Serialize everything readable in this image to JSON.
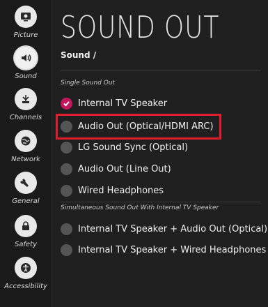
{
  "sidebar": {
    "items": [
      {
        "label": "Picture",
        "icon": "picture-icon"
      },
      {
        "label": "Sound",
        "icon": "speaker-icon"
      },
      {
        "label": "Channels",
        "icon": "antenna-icon"
      },
      {
        "label": "Network",
        "icon": "globe-icon"
      },
      {
        "label": "General",
        "icon": "wrench-icon"
      },
      {
        "label": "Safety",
        "icon": "lock-icon"
      },
      {
        "label": "Accessibility",
        "icon": "accessibility-icon"
      }
    ]
  },
  "header": {
    "title": "SOUND OUT",
    "breadcrumb": "Sound /"
  },
  "sections": {
    "single": {
      "label": "Single Sound Out",
      "options": [
        {
          "label": "Internal TV Speaker",
          "selected": true
        },
        {
          "label": "Audio Out (Optical/HDMI ARC)",
          "selected": false
        },
        {
          "label": "LG Sound Sync (Optical)",
          "selected": false
        },
        {
          "label": "Audio Out (Line Out)",
          "selected": false
        },
        {
          "label": "Wired Headphones",
          "selected": false
        }
      ]
    },
    "simultaneous": {
      "label": "Simultaneous Sound Out With Internal TV Speaker",
      "options": [
        {
          "label": "Internal TV Speaker + Audio Out (Optical)",
          "selected": false
        },
        {
          "label": "Internal TV Speaker + Wired Headphones",
          "selected": false
        }
      ]
    }
  },
  "colors": {
    "accent": "#c2185b",
    "highlight": "#e01e2e"
  }
}
